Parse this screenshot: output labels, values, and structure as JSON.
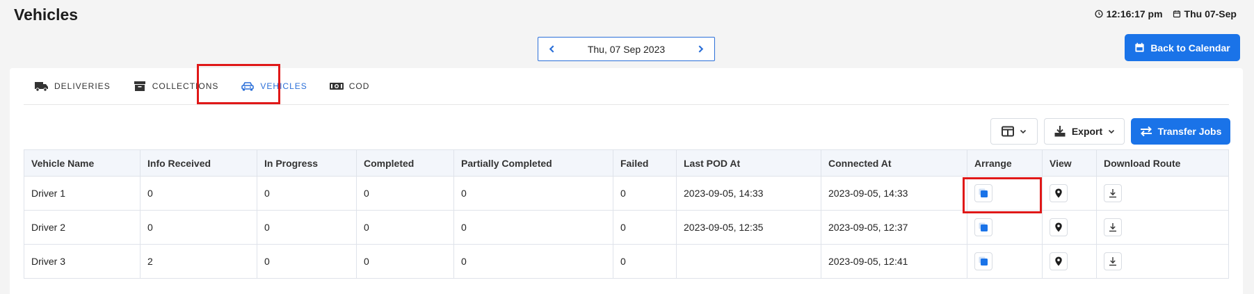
{
  "header": {
    "title": "Vehicles",
    "time": "12:16:17 pm",
    "date": "Thu 07-Sep"
  },
  "date_nav": {
    "label": "Thu, 07 Sep 2023"
  },
  "back_button_label": "Back to Calendar",
  "tabs": [
    {
      "label": "DELIVERIES",
      "icon": "truck-icon"
    },
    {
      "label": "COLLECTIONS",
      "icon": "box-icon"
    },
    {
      "label": "VEHICLES",
      "icon": "car-icon",
      "active": true
    },
    {
      "label": "COD",
      "icon": "cash-icon"
    }
  ],
  "toolbar": {
    "export_label": "Export",
    "transfer_label": "Transfer Jobs"
  },
  "table": {
    "headers": [
      "Vehicle Name",
      "Info Received",
      "In Progress",
      "Completed",
      "Partially Completed",
      "Failed",
      "Last POD At",
      "Connected At",
      "Arrange",
      "View",
      "Download Route"
    ],
    "rows": [
      [
        "Driver 1",
        "0",
        "0",
        "0",
        "0",
        "0",
        "2023-09-05, 14:33",
        "2023-09-05, 14:33"
      ],
      [
        "Driver 2",
        "0",
        "0",
        "0",
        "0",
        "0",
        "2023-09-05, 12:35",
        "2023-09-05, 12:37"
      ],
      [
        "Driver 3",
        "2",
        "0",
        "0",
        "0",
        "0",
        "",
        "2023-09-05, 12:41"
      ]
    ]
  },
  "colors": {
    "accent": "#1a73e8",
    "highlight": "#e01818"
  }
}
